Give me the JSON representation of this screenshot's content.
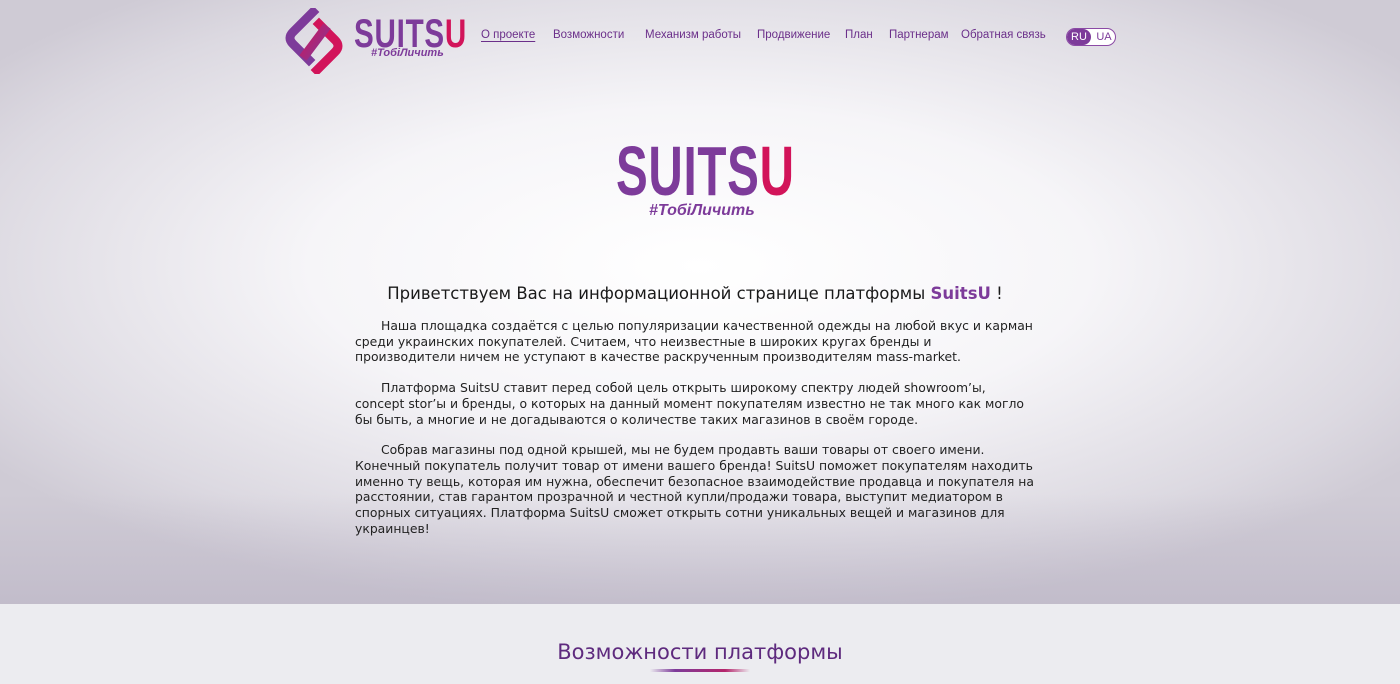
{
  "header": {
    "logo": {
      "word_main": "SUITS",
      "word_accent": "U",
      "tagline": "#ТобіЛичить"
    },
    "nav": [
      {
        "label": "О проекте",
        "active": true
      },
      {
        "label": "Возможности",
        "active": false
      },
      {
        "label": "Механизм работы",
        "active": false
      },
      {
        "label": "Продвижение",
        "active": false
      },
      {
        "label": "План",
        "active": false
      },
      {
        "label": "Партнерам",
        "active": false
      },
      {
        "label": "Обратная связь",
        "active": false
      }
    ],
    "languages": {
      "selected": "RU",
      "other": "UA"
    }
  },
  "hero": {
    "logo": {
      "word_main": "SUITS",
      "word_accent": "U",
      "tagline": "#ТобіЛичить"
    },
    "welcome_before": "Приветствуем Вас на информационной странице платформы ",
    "welcome_brand": "SuitsU",
    "welcome_after": " !",
    "paragraphs": [
      "Наша площадка создаётся с целью популяризации  качественной одежды на любой вкус и карман среди украинских покупателей. Считаем, что неизвестные в широких кругах бренды и производители ничем не уступают в качестве раскрученным производителям mass-market.",
      "Платформа SuitsU ставит перед собой цель открыть широкому спектру людей showroom’ы, concept stor’ы и бренды, о которых на данный момент покупателям известно не так много как могло бы быть, а многие и не догадываются о количестве таких магазинов в своём городе.",
      "Собрав магазины под одной крышей, мы не будем продавть ваши товары от своего имени. Конечный покупатель получит товар от имени вашего бренда! SuitsU поможет покупателям находить именно ту вещь, которая им нужна, обеспечит безопасное взаимодействие продавца и покупателя на расстоянии, став гарантом прозрачной и честной купли/продажи товара, выступит медиатором в спорных ситуациях. Платформа SuitsU сможет открыть сотни уникальных вещей и магазинов для украинцев!"
    ]
  },
  "features": {
    "title": "Возможности платформы"
  },
  "colors": {
    "purple": "#7d3b9a",
    "accent": "#d2145a"
  }
}
